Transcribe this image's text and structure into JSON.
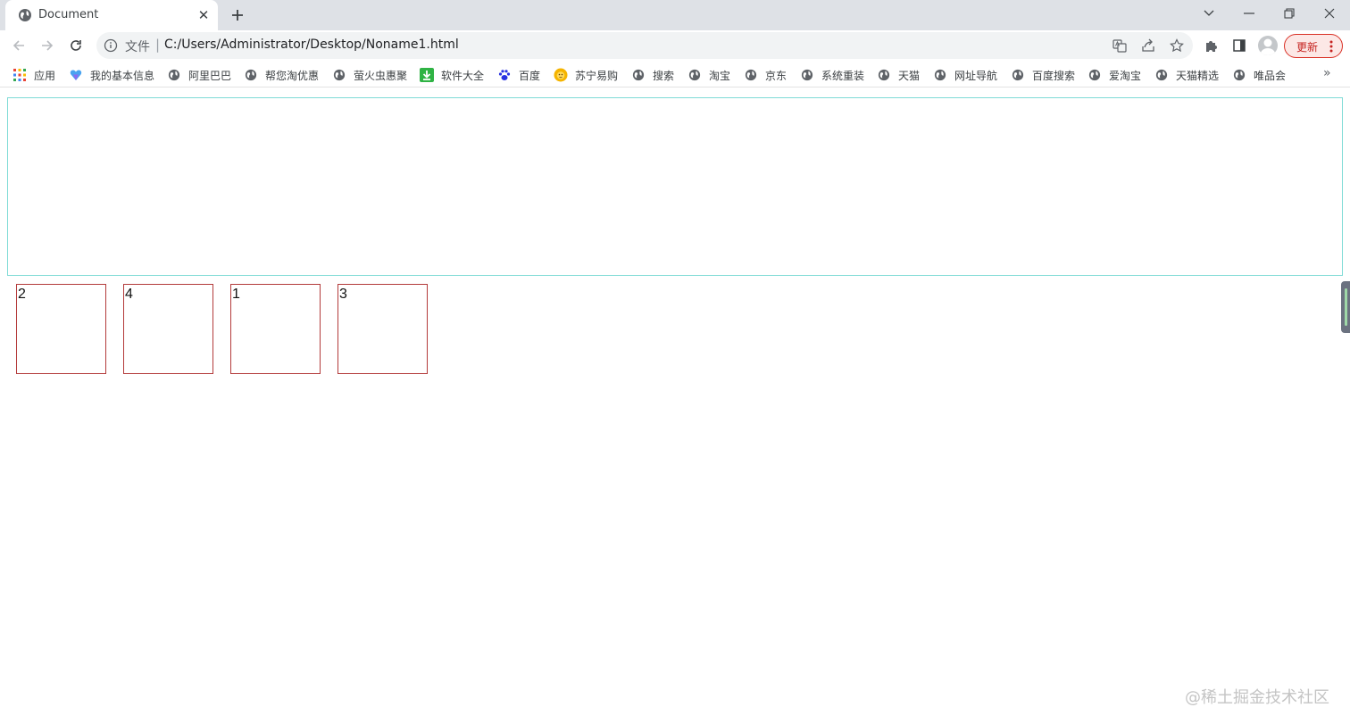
{
  "tab": {
    "title": "Document",
    "close_glyph": "✕",
    "new_tab_glyph": "+"
  },
  "window_controls": {
    "tab_search_glyph": "⌄",
    "minimize_glyph": "—",
    "restore_glyph": "❐",
    "close_glyph": "✕"
  },
  "address_bar": {
    "scheme_label": "文件",
    "separator": "|",
    "url": "C:/Users/Administrator/Desktop/Noname1.html"
  },
  "toolbar": {
    "update_label": "更新"
  },
  "bookmarks": {
    "items": [
      {
        "label": "应用",
        "icon": "apps-grid-icon"
      },
      {
        "label": "我的基本信息",
        "icon": "heart-gem-icon"
      },
      {
        "label": "阿里巴巴",
        "icon": "globe-icon"
      },
      {
        "label": "帮您淘优惠",
        "icon": "globe-icon"
      },
      {
        "label": "萤火虫惠聚",
        "icon": "globe-icon"
      },
      {
        "label": "软件大全",
        "icon": "download-icon"
      },
      {
        "label": "百度",
        "icon": "paw-icon"
      },
      {
        "label": "苏宁易购",
        "icon": "lion-icon"
      },
      {
        "label": "搜索",
        "icon": "globe-icon"
      },
      {
        "label": "淘宝",
        "icon": "globe-icon"
      },
      {
        "label": "京东",
        "icon": "globe-icon"
      },
      {
        "label": "系统重装",
        "icon": "globe-icon"
      },
      {
        "label": "天猫",
        "icon": "globe-icon"
      },
      {
        "label": "网址导航",
        "icon": "globe-icon"
      },
      {
        "label": "百度搜索",
        "icon": "globe-icon"
      },
      {
        "label": "爱淘宝",
        "icon": "globe-icon"
      },
      {
        "label": "天猫精选",
        "icon": "globe-icon"
      },
      {
        "label": "唯品会",
        "icon": "globe-icon"
      }
    ],
    "more_glyph": "»"
  },
  "page": {
    "boxes": [
      "2",
      "4",
      "1",
      "3"
    ],
    "watermark": "@稀土掘金技术社区"
  },
  "colors": {
    "top_box_border": "#7fdbd6",
    "small_box_border": "#b33a3a",
    "update_accent": "#d93025"
  }
}
